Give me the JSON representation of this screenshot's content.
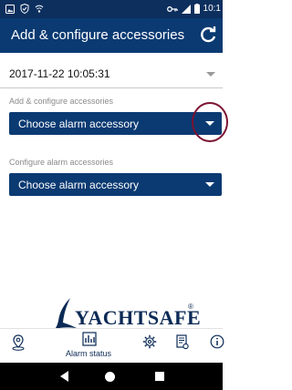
{
  "status_bar": {
    "time": "10:1"
  },
  "app_bar": {
    "title": "Add & configure accessories"
  },
  "date_selector": {
    "value": "2017-11-22 10:05:31"
  },
  "add_section": {
    "label": "Add & configure accessories",
    "select_value": "Choose alarm accessory"
  },
  "configure_section": {
    "label": "Configure alarm accessories",
    "select_value": "Choose alarm accessory"
  },
  "logo": {
    "text": "YACHTSAFE",
    "reg": "®"
  },
  "bottom_nav": {
    "items": [
      {
        "icon": "location-icon"
      },
      {
        "icon": "alarm-status-icon",
        "label": "Alarm status"
      },
      {
        "icon": "gear-icon"
      },
      {
        "icon": "document-settings-icon"
      },
      {
        "icon": "info-icon"
      }
    ]
  },
  "colors": {
    "primary": "#0b3a72",
    "status_bar": "#0c2f5e",
    "highlight_ring": "#7b1232",
    "logo": "#0b2a55"
  }
}
